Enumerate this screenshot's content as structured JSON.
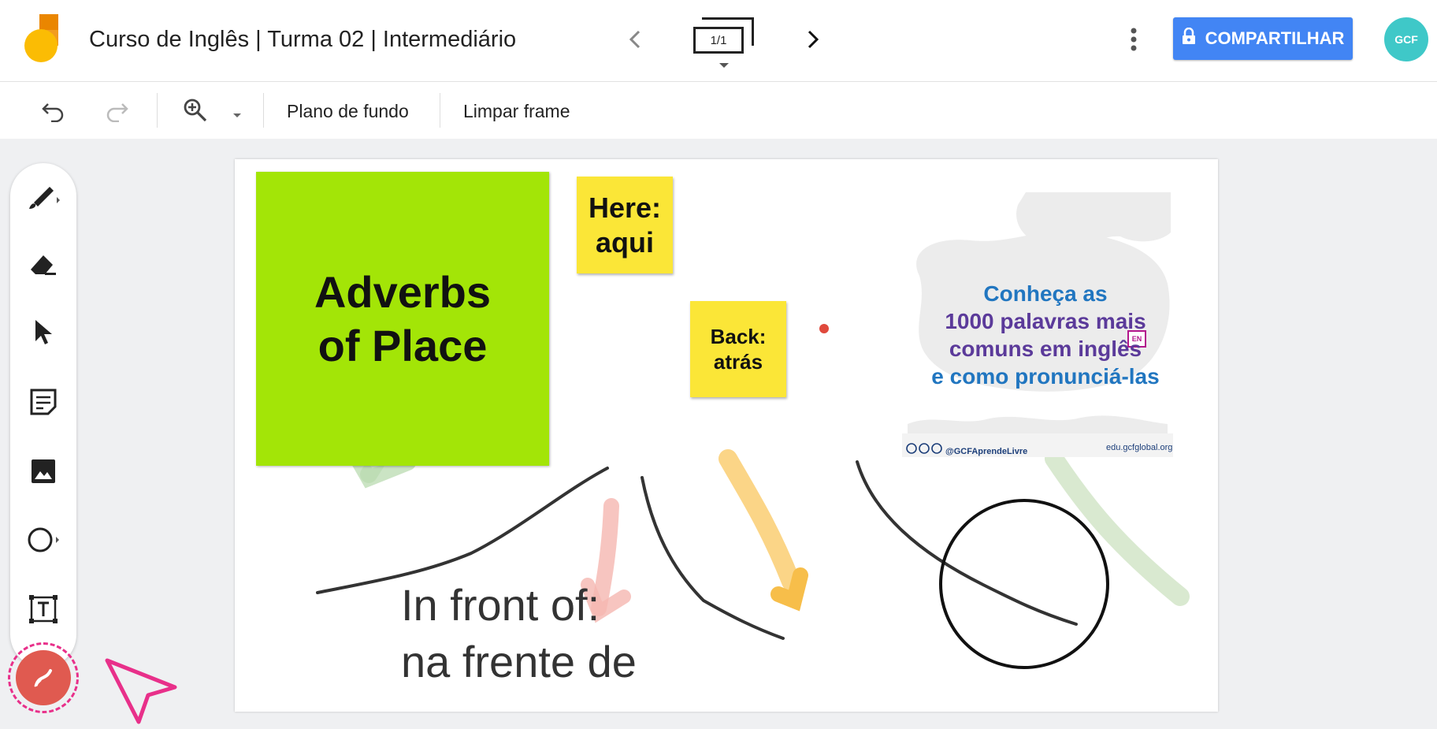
{
  "header": {
    "title": "Curso de Inglês | Turma 02 | Intermediário",
    "frame_counter": "1/1",
    "share_label": "COMPARTILHAR",
    "avatar_text": "GCF",
    "icons": [
      "jamboard-logo-icon",
      "chevron-left-icon",
      "frames-icon",
      "chevron-right-icon",
      "more-vert-icon",
      "lock-icon"
    ]
  },
  "toolbar": {
    "background_label": "Plano de fundo",
    "clear_label": "Limpar frame",
    "icons": [
      "undo-icon",
      "redo-icon",
      "zoom-in-icon",
      "dropdown-arrow-icon"
    ]
  },
  "tools": [
    "pen-icon",
    "eraser-icon",
    "select-icon",
    "sticky-note-icon",
    "image-icon",
    "circle-icon",
    "text-box-icon",
    "laser-icon"
  ],
  "canvas": {
    "green_note": "Adverbs of Place",
    "note_here": "Here: aqui",
    "note_back": "Back: atrás",
    "handwritten_line1": "In front of:",
    "handwritten_line2": "na frente de",
    "promo": {
      "line1": "Conheça as",
      "line2": "1000 palavras mais",
      "line3": "comuns em inglês",
      "line4": "e como pronunciá-las",
      "social": "@GCFAprendeLivre",
      "url": "edu.gcfglobal.org",
      "flag_label": "EN"
    }
  },
  "colors": {
    "share": "#4285f4",
    "green_note": "#a3e507",
    "yellow_note": "#fbe637",
    "laser": "#e05a50",
    "cursor_highlight": "#e8308a"
  }
}
